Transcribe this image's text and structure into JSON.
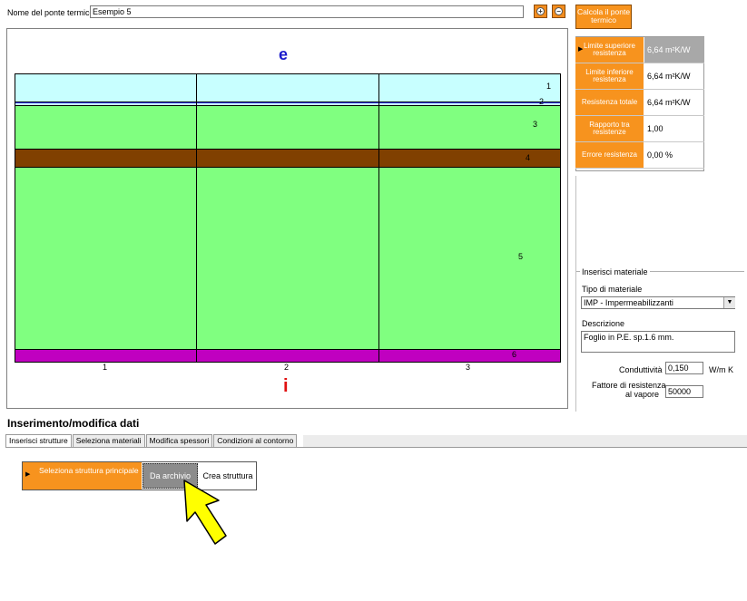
{
  "header": {
    "bridge_name_label": "Nome del ponte termico",
    "bridge_name_value": "Esempio 5",
    "compute_button": "Calcola il ponte termico"
  },
  "canvas": {
    "top_label": "e",
    "bottom_label": "i",
    "layers": [
      {
        "number": "1",
        "color": "#c8ffff"
      },
      {
        "number": "2",
        "color": "#3a3aff"
      },
      {
        "number": "3",
        "color": "#80ff80"
      },
      {
        "number": "4",
        "color": "#804000"
      },
      {
        "number": "5",
        "color": "#80ff80"
      },
      {
        "number": "6",
        "color": "#c000c0"
      }
    ],
    "column_numbers": [
      "1",
      "2",
      "3"
    ]
  },
  "results": [
    {
      "key": "Limite superiore resistenza",
      "value": "6,64 m²K/W",
      "selected": true
    },
    {
      "key": "Limite inferiore resistenza",
      "value": "6,64 m²K/W",
      "selected": false
    },
    {
      "key": "Resistenza totale",
      "value": "6,64 m²K/W",
      "selected": false
    },
    {
      "key": "Rapporto tra resistenze",
      "value": "1,00",
      "selected": false
    },
    {
      "key": "Errore resistenza",
      "value": "0,00 %",
      "selected": false
    }
  ],
  "material_panel": {
    "group_title": "Inserisci materiale",
    "type_label": "Tipo di materiale",
    "type_value": "IMP - Impermeabilizzanti",
    "description_label": "Descrizione",
    "description_value": "Foglio in P.E. sp.1.6 mm.",
    "conductivity_label": "Conduttività",
    "conductivity_value": "0,150",
    "conductivity_unit": "W/m K",
    "vapor_label_line1": "Fattore di resistenza",
    "vapor_label_line2": "al vapore",
    "vapor_value": "50000"
  },
  "data_section": {
    "title": "Inserimento/modifica dati",
    "tabs": [
      "Inserisci strutture",
      "Seleziona materiali",
      "Modifica spessori",
      "Condizioni al contorno"
    ],
    "main_structure_label": "Seleziona struttura principale",
    "from_archive_button": "Da archivio",
    "create_structure_button": "Crea struttura"
  },
  "colors": {
    "accent_orange": "#f7931e",
    "selected_grey": "#a8a8a8",
    "arrow_yellow": "#ffff00"
  }
}
